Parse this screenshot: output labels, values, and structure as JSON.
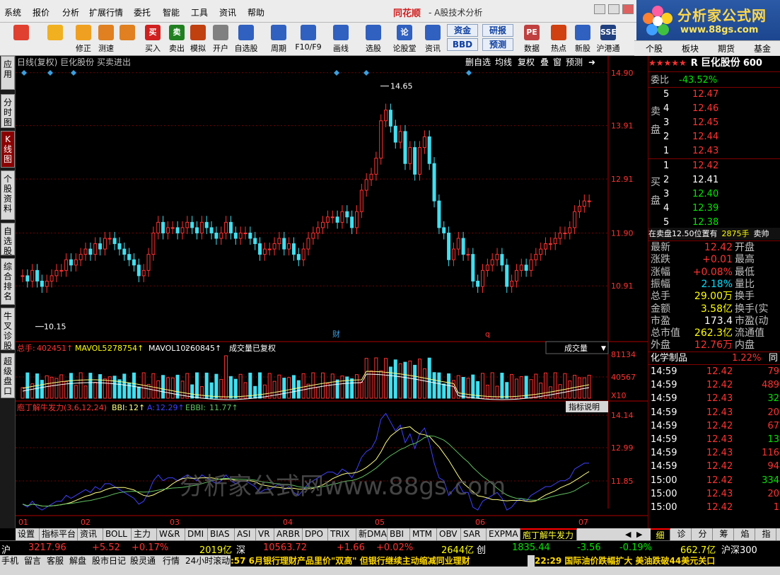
{
  "menu": [
    "系统",
    "报价",
    "分析",
    "扩展行情",
    "委托",
    "智能",
    "工具",
    "资讯",
    "帮助"
  ],
  "app_logo": "同花顺",
  "app_title": "- A股技术分析",
  "brand": {
    "name": "分析家公式网",
    "url": "www.88gs.com"
  },
  "toolbar": [
    {
      "label": "",
      "icon": "squares-icon",
      "color": "#e04030"
    },
    {
      "label": "",
      "icon": "back-arrow-icon",
      "color": "#f0b020"
    },
    {
      "label": "修正",
      "icon": "up-down-icon",
      "color": "#f0a020"
    },
    {
      "label": "测速",
      "icon": "speed-icon",
      "color": "#e08020"
    },
    {
      "label": "",
      "icon": "clock-icon",
      "color": "#e08020"
    },
    {
      "label": "买入",
      "icon": "buy-icon",
      "text": "买",
      "color": "#d02020"
    },
    {
      "label": "卖出",
      "icon": "sell-icon",
      "text": "卖",
      "color": "#208020"
    },
    {
      "label": "模拟",
      "icon": "hammer-icon",
      "color": "#c04010"
    },
    {
      "label": "开户",
      "icon": "lock-icon",
      "color": "#808080"
    },
    {
      "label": "自选股",
      "icon": "star-icon",
      "color": "#3060c0"
    },
    {
      "label": "周期",
      "icon": "cycle-icon",
      "color": "#3060c0"
    },
    {
      "label": "F10/F9",
      "icon": "f10-icon",
      "color": "#3060c0"
    },
    {
      "label": "画线",
      "icon": "pen-icon",
      "color": "#3060c0"
    },
    {
      "label": "选股",
      "icon": "screen-icon",
      "color": "#3060c0"
    },
    {
      "label": "论股堂",
      "icon": "forum-icon",
      "text": "论",
      "color": "#3060c0"
    },
    {
      "label": "资讯",
      "icon": "news-icon",
      "color": "#3060c0"
    },
    {
      "label": "数据",
      "icon": "pe-icon",
      "text": "PE",
      "color": "#c04040"
    },
    {
      "label": "热点",
      "icon": "hot-icon",
      "color": "#d04010"
    },
    {
      "label": "新股",
      "icon": "new-stock-icon",
      "color": "#3060c0"
    },
    {
      "label": "沪港通",
      "icon": "hk-icon",
      "text": "SSE",
      "color": "#204080"
    }
  ],
  "toolbar_text_buttons": [
    "资金",
    "研报",
    "BBD",
    "预测"
  ],
  "right_tabs": [
    "个股",
    "板块",
    "期货",
    "基金"
  ],
  "left_tabs": [
    {
      "label": "应用",
      "active": false
    },
    {
      "label": "分时图",
      "active": false
    },
    {
      "label": "K线图",
      "active": true
    },
    {
      "label": "个股资料",
      "active": false
    },
    {
      "label": "自选股",
      "active": false
    },
    {
      "label": "综合排名",
      "active": false
    },
    {
      "label": "牛叉诊股",
      "active": false
    },
    {
      "label": "超级盘口",
      "active": false
    }
  ],
  "chart_header": {
    "left": "日线(复权)  巨化股份  买卖进出",
    "right_buttons": [
      "删自选",
      "均线",
      "复权",
      "叠",
      "窗",
      "预测"
    ]
  },
  "volume_header": {
    "label": "总手:",
    "total": "402451",
    "mavol5_label": "MAVOL5:",
    "mavol5": "278754",
    "mavol10_label": "MAVOL10:",
    "mavol10": "260845",
    "note": "成交量已复权",
    "dropdown": "成交量"
  },
  "bbi_header": {
    "title": "庖丁解牛发力(3,6,12,24)",
    "bbi_label": "BBI:",
    "bbi": "12",
    "a_label": "A:",
    "a": "12.29",
    "ebbi_label": "EBBI:",
    "ebbi": "11.77",
    "button": "指标说明"
  },
  "watermark": "分析家公式网www.88gs.com",
  "chart_data": [
    {
      "type": "candlestick",
      "title": "巨化股份 日线(复权)",
      "y_ticks": [
        "14.90",
        "13.91",
        "12.91",
        "11.90",
        "10.91"
      ],
      "ylim": [
        10.0,
        14.95
      ],
      "high_label": "14.65",
      "low_label": "10.15",
      "x_ticks": [
        "01",
        "02",
        "03",
        "04",
        "05",
        "06",
        "07"
      ],
      "markers": [
        "财",
        "q"
      ]
    },
    {
      "type": "bar",
      "title": "成交量",
      "y_ticks": [
        "81134",
        "40567"
      ],
      "unit": "X10",
      "series": [
        {
          "name": "MAVOL5",
          "value": 278754
        },
        {
          "name": "MAVOL10",
          "value": 260845
        }
      ]
    },
    {
      "type": "line",
      "title": "庖丁解牛发力",
      "y_ticks": [
        "14.14",
        "12.99",
        "11.85"
      ],
      "series": [
        {
          "name": "BBI",
          "color": "#ffff80"
        },
        {
          "name": "A",
          "color": "#4040ff"
        },
        {
          "name": "EBBI",
          "color": "#60c060"
        }
      ]
    }
  ],
  "quote": {
    "stars": "★★★★★",
    "flag": "R",
    "name": "巨化股份",
    "code": "600",
    "webi": {
      "label": "委比",
      "value": "-43.52%"
    },
    "sell_label": "卖盘",
    "buy_label": "买盘",
    "asks": [
      {
        "lvl": "5",
        "price": "12.47"
      },
      {
        "lvl": "4",
        "price": "12.46"
      },
      {
        "lvl": "3",
        "price": "12.45"
      },
      {
        "lvl": "2",
        "price": "12.44"
      },
      {
        "lvl": "1",
        "price": "12.43"
      }
    ],
    "bids": [
      {
        "lvl": "1",
        "price": "12.42"
      },
      {
        "lvl": "2",
        "price": "12.41"
      },
      {
        "lvl": "3",
        "price": "12.40"
      },
      {
        "lvl": "4",
        "price": "12.39"
      },
      {
        "lvl": "5",
        "price": "12.38"
      }
    ],
    "pending": "在卖盘12.50位置有",
    "pending_vol": "2875手",
    "pending_suffix": "卖帅",
    "stats": [
      {
        "k": "最新",
        "v": "12.42",
        "c": "red",
        "k2": "开盘"
      },
      {
        "k": "涨跌",
        "v": "+0.01",
        "c": "red",
        "k2": "最高"
      },
      {
        "k": "涨幅",
        "v": "+0.08%",
        "c": "red",
        "k2": "最低"
      },
      {
        "k": "振幅",
        "v": "2.18%",
        "c": "cyan",
        "k2": "量比"
      },
      {
        "k": "总手",
        "v": "29.00万",
        "c": "yellow",
        "k2": "换手"
      },
      {
        "k": "金额",
        "v": "3.58亿",
        "c": "yellow",
        "k2": "换手(实"
      },
      {
        "k": "市盈",
        "v": "173.4",
        "c": "white",
        "k2": "市盈(动"
      },
      {
        "k": "总市值",
        "v": "262.3亿",
        "c": "yellow",
        "k2": "流通值"
      },
      {
        "k": "外盘",
        "v": "12.76万",
        "c": "red",
        "k2": "内盘"
      }
    ],
    "sector": {
      "name": "化学制品",
      "change": "1.22%",
      "suffix": "同"
    },
    "ticks": [
      {
        "t": "14:59",
        "p": "12.42",
        "v": "79"
      },
      {
        "t": "14:59",
        "p": "12.42",
        "v": "489"
      },
      {
        "t": "14:59",
        "p": "12.43",
        "v": "32"
      },
      {
        "t": "14:59",
        "p": "12.43",
        "v": "20"
      },
      {
        "t": "14:59",
        "p": "12.42",
        "v": "67"
      },
      {
        "t": "14:59",
        "p": "12.43",
        "v": "13"
      },
      {
        "t": "14:59",
        "p": "12.43",
        "v": "116"
      },
      {
        "t": "14:59",
        "p": "12.42",
        "v": "94"
      },
      {
        "t": "15:00",
        "p": "12.42",
        "v": "334"
      },
      {
        "t": "15:00",
        "p": "12.43",
        "v": "20"
      },
      {
        "t": "15:00",
        "p": "12.42",
        "v": "1"
      }
    ]
  },
  "bottom_tabs": [
    "设置",
    "指标平台",
    "资讯",
    "BOLL",
    "主力",
    "W&R",
    "DMI",
    "BIAS",
    "ASI",
    "VR",
    "ARBR",
    "DPO",
    "TRIX",
    "新DMA",
    "BBI",
    "MTM",
    "OBV",
    "SAR",
    "EXPMA",
    "庖丁解牛发力"
  ],
  "bottom_tabs_active": "庖丁解牛发力",
  "right_bottom_tabs": [
    "细",
    "诊",
    "分",
    "筹",
    "焰",
    "指"
  ],
  "ticker": {
    "sh_label": "沪",
    "sh_index": "3217.96",
    "sh_chg": "+5.52",
    "sh_pct": "+0.17%",
    "sh_amt": "2019亿",
    "sz_label": "深",
    "sz_index": "10563.72",
    "sz_chg": "+1.66",
    "sz_pct": "+0.02%",
    "sz_amt": "2644亿",
    "cy_label": "创",
    "cy_index": "1835.44",
    "cy_chg": "-3.56",
    "cy_pct": "-0.19%",
    "hgt_amt": "662.7亿",
    "hgt_label": "沪深300"
  },
  "status": [
    "手机",
    "留言",
    "客服",
    "解盘",
    "股市日记",
    "股灵通",
    "行情",
    "24小时滚动"
  ],
  "news": [
    ":57 6月银行理财产品里价\"双高\" 但银行继续主动缩减同业理财",
    "22:29 国际油价跌幅扩大 美油跌破44美元关口"
  ]
}
